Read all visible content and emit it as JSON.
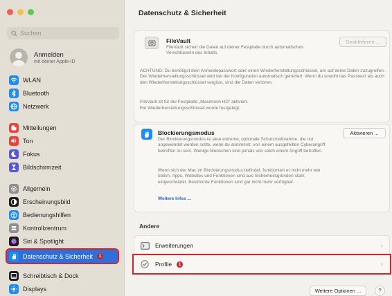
{
  "window": {
    "title": "Datenschutz & Sicherheit",
    "traffic_lights": [
      "#ec5f56",
      "#f4bf4f",
      "#61c454"
    ]
  },
  "sidebar": {
    "search_placeholder": "Suchen",
    "account": {
      "name": "Anmelden",
      "subtitle": "mit deiner Apple-ID"
    },
    "items": [
      {
        "label": "WLAN",
        "icon": "wifi-icon",
        "color": "#1e8cf0"
      },
      {
        "label": "Bluetooth",
        "icon": "bluetooth-icon",
        "color": "#1e8cf0"
      },
      {
        "label": "Netzwerk",
        "icon": "globe-icon",
        "color": "#1e8cf0"
      },
      {
        "label": "Mitteilungen",
        "icon": "bell-icon",
        "color": "#e9443c"
      },
      {
        "label": "Ton",
        "icon": "speaker-icon",
        "color": "#e9443c"
      },
      {
        "label": "Fokus",
        "icon": "moon-icon",
        "color": "#5856d6"
      },
      {
        "label": "Bildschirmzeit",
        "icon": "hourglass-icon",
        "color": "#5856d6"
      },
      {
        "label": "Allgemein",
        "icon": "gear-icon",
        "color": "#8e8e93"
      },
      {
        "label": "Erscheinungsbild",
        "icon": "appearance-icon",
        "color": "#1c1c1e"
      },
      {
        "label": "Bedienungshilfen",
        "icon": "accessibility-icon",
        "color": "#1e8cf0"
      },
      {
        "label": "Kontrollzentrum",
        "icon": "control-center-icon",
        "color": "#8e8e93"
      },
      {
        "label": "Siri & Spotlight",
        "icon": "siri-icon",
        "color": "#1c1c1e"
      },
      {
        "label": "Datenschutz & Sicherheit",
        "icon": "hand-icon",
        "color": "#1e8cf0",
        "active": true,
        "badge": "1"
      },
      {
        "label": "Schreibtisch & Dock",
        "icon": "dock-icon",
        "color": "#1c1c1e"
      },
      {
        "label": "Displays",
        "icon": "display-icon",
        "color": "#1e8cf0"
      }
    ]
  },
  "filevault": {
    "title": "FileVault",
    "desc": "FileVault sichert die Daten auf deiner Festplatte durch automatisches Verschlüsseln des Inhalts.",
    "button": "Deaktivieren ...",
    "warning": "ACHTUNG: Du benötigst dein Anmeldepasswort oder einen Wiederherstellungsschlüssel, um auf deine Daten zuzugreifen. Der Wiederherstellungsschlüssel wird bei der Konfiguration automatisch generiert. Wenn du sowohl das Passwort als auch den Wiederherstellungsschlüssel vergisst, sind die Daten verloren.",
    "status": "FileVault ist für die Festplatte „Macintosh HD“ aktiviert.",
    "status2": "Ein Wiederherstellungsschlüssel wurde festgelegt."
  },
  "lockdown": {
    "title": "Blockierungsmodus",
    "desc": "Der Blockierungsmodus ist eine extreme, optionale Schutzmaßnahme, die nur angewendet werden sollte, wenn du annimmst, von einem ausgefeilten Cyberangriff betroffen zu sein. Wenige Menschen sind jemals von solch einem Angriff betroffen.",
    "desc2": "Wenn sich der Mac im Blockierungsmodus befindet, funktioniert er nicht mehr wie üblich. Apps, Websites und Funktionen sind aus Sicherheitsgründen stark eingeschränkt. Bestimmte Funktionen sind gar nicht mehr verfügbar.",
    "link": "Weitere Infos ...",
    "button": "Aktivieren ..."
  },
  "other": {
    "heading": "Andere",
    "rows": [
      {
        "label": "Erweiterungen",
        "icon": "extensions-icon"
      },
      {
        "label": "Profile",
        "icon": "checkmark-badge-icon",
        "badge": "1"
      }
    ]
  },
  "footer": {
    "more_button": "Weitere Optionen ...",
    "help": "?"
  }
}
